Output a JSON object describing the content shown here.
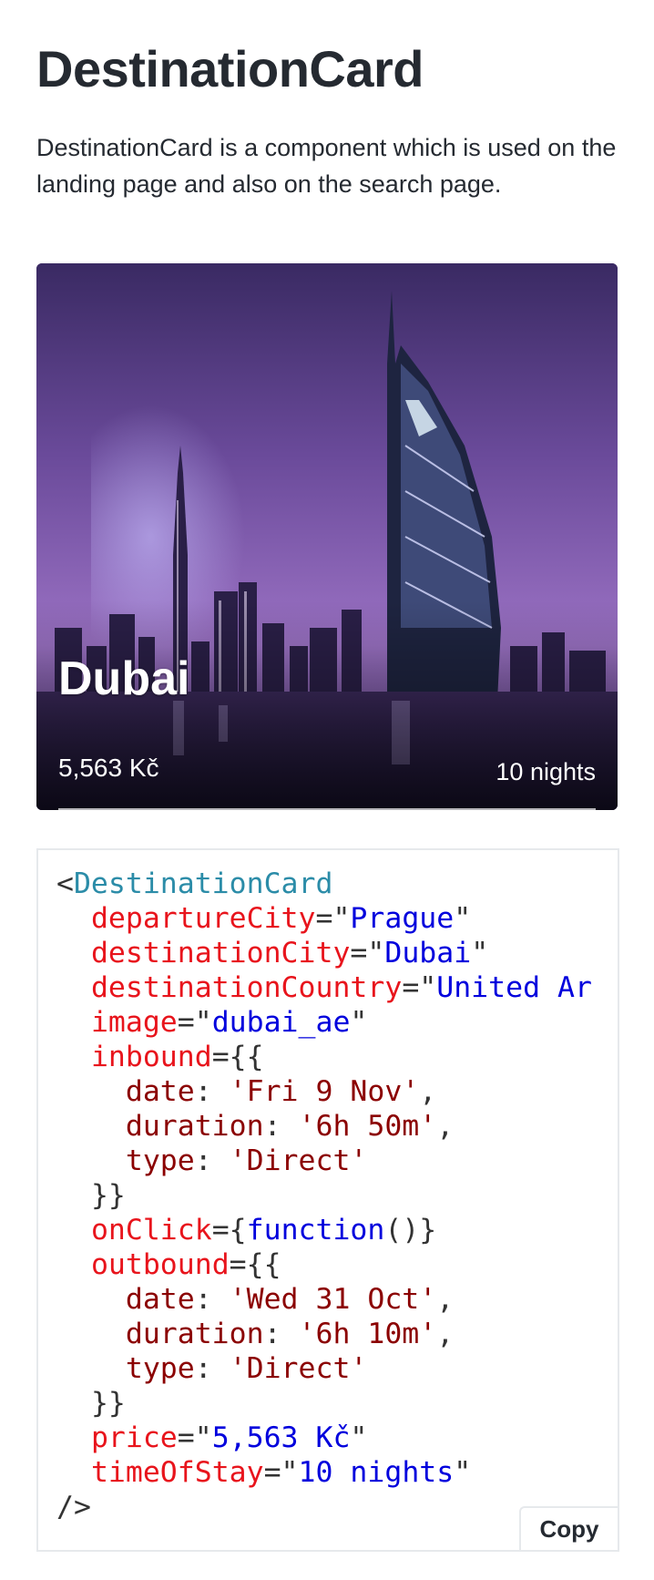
{
  "page": {
    "title": "DestinationCard",
    "description": "DestinationCard is a component which is used on the landing page and also on the search page."
  },
  "card": {
    "city": "Dubai",
    "price": "5,563 Kč",
    "stay": "10 nights"
  },
  "code": {
    "component": "DestinationCard",
    "props": [
      {
        "name": "departureCity",
        "value": "Prague"
      },
      {
        "name": "destinationCity",
        "value": "Dubai"
      },
      {
        "name": "destinationCountry",
        "value": "United Ar"
      },
      {
        "name": "image",
        "value": "dubai_ae"
      }
    ],
    "inbound": {
      "name": "inbound",
      "date_key": "date",
      "date": "'Fri 9 Nov'",
      "duration_key": "duration",
      "duration": "'6h 50m'",
      "type_key": "type",
      "type": "'Direct'"
    },
    "onClick": {
      "name": "onClick",
      "value": "function"
    },
    "outbound": {
      "name": "outbound",
      "date_key": "date",
      "date": "'Wed 31 Oct'",
      "duration_key": "duration",
      "duration": "'6h 10m'",
      "type_key": "type",
      "type": "'Direct'"
    },
    "price": {
      "name": "price",
      "value": "5,563 Kč"
    },
    "timeOfStay": {
      "name": "timeOfStay",
      "value": "10 nights"
    },
    "copy_label": "Copy"
  },
  "colors": {
    "tag": "#2b8ca8",
    "attribute": "#e8141c",
    "string": "#0000dd",
    "js_string": "#8b0000"
  }
}
